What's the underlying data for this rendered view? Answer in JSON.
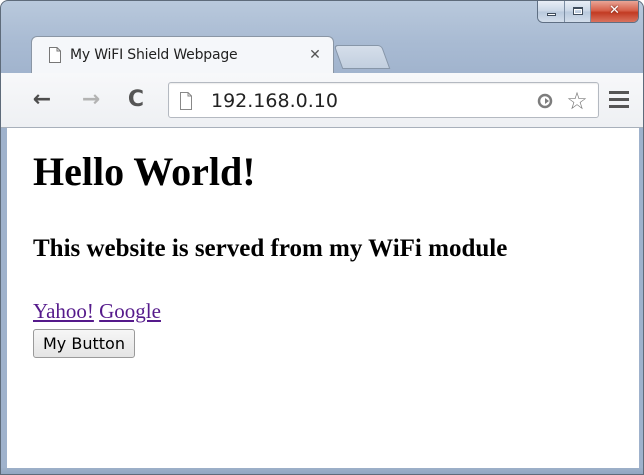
{
  "window": {
    "caption_buttons": [
      "minimize",
      "maximize",
      "close"
    ],
    "colors": {
      "frame": "#a9bbd3",
      "close_button": "#c9432b",
      "link_visited": "#551a8b"
    }
  },
  "tab": {
    "title": "My WiFI Shield Webpage",
    "close_glyph": "✕",
    "icon": "page-icon"
  },
  "toolbar": {
    "back_glyph": "←",
    "forward_glyph": "→",
    "reload_glyph": "C",
    "url": "192.168.0.10",
    "star_glyph": "☆",
    "icons": [
      "back-arrow-icon",
      "forward-arrow-icon",
      "reload-icon",
      "page-icon",
      "search-icon",
      "star-icon",
      "menu-icon"
    ]
  },
  "page": {
    "heading": "Hello World!",
    "subheading": "This website is served from my WiFi module",
    "links": [
      {
        "label": "Yahoo!"
      },
      {
        "label": "Google"
      }
    ],
    "button_label": "My Button"
  }
}
